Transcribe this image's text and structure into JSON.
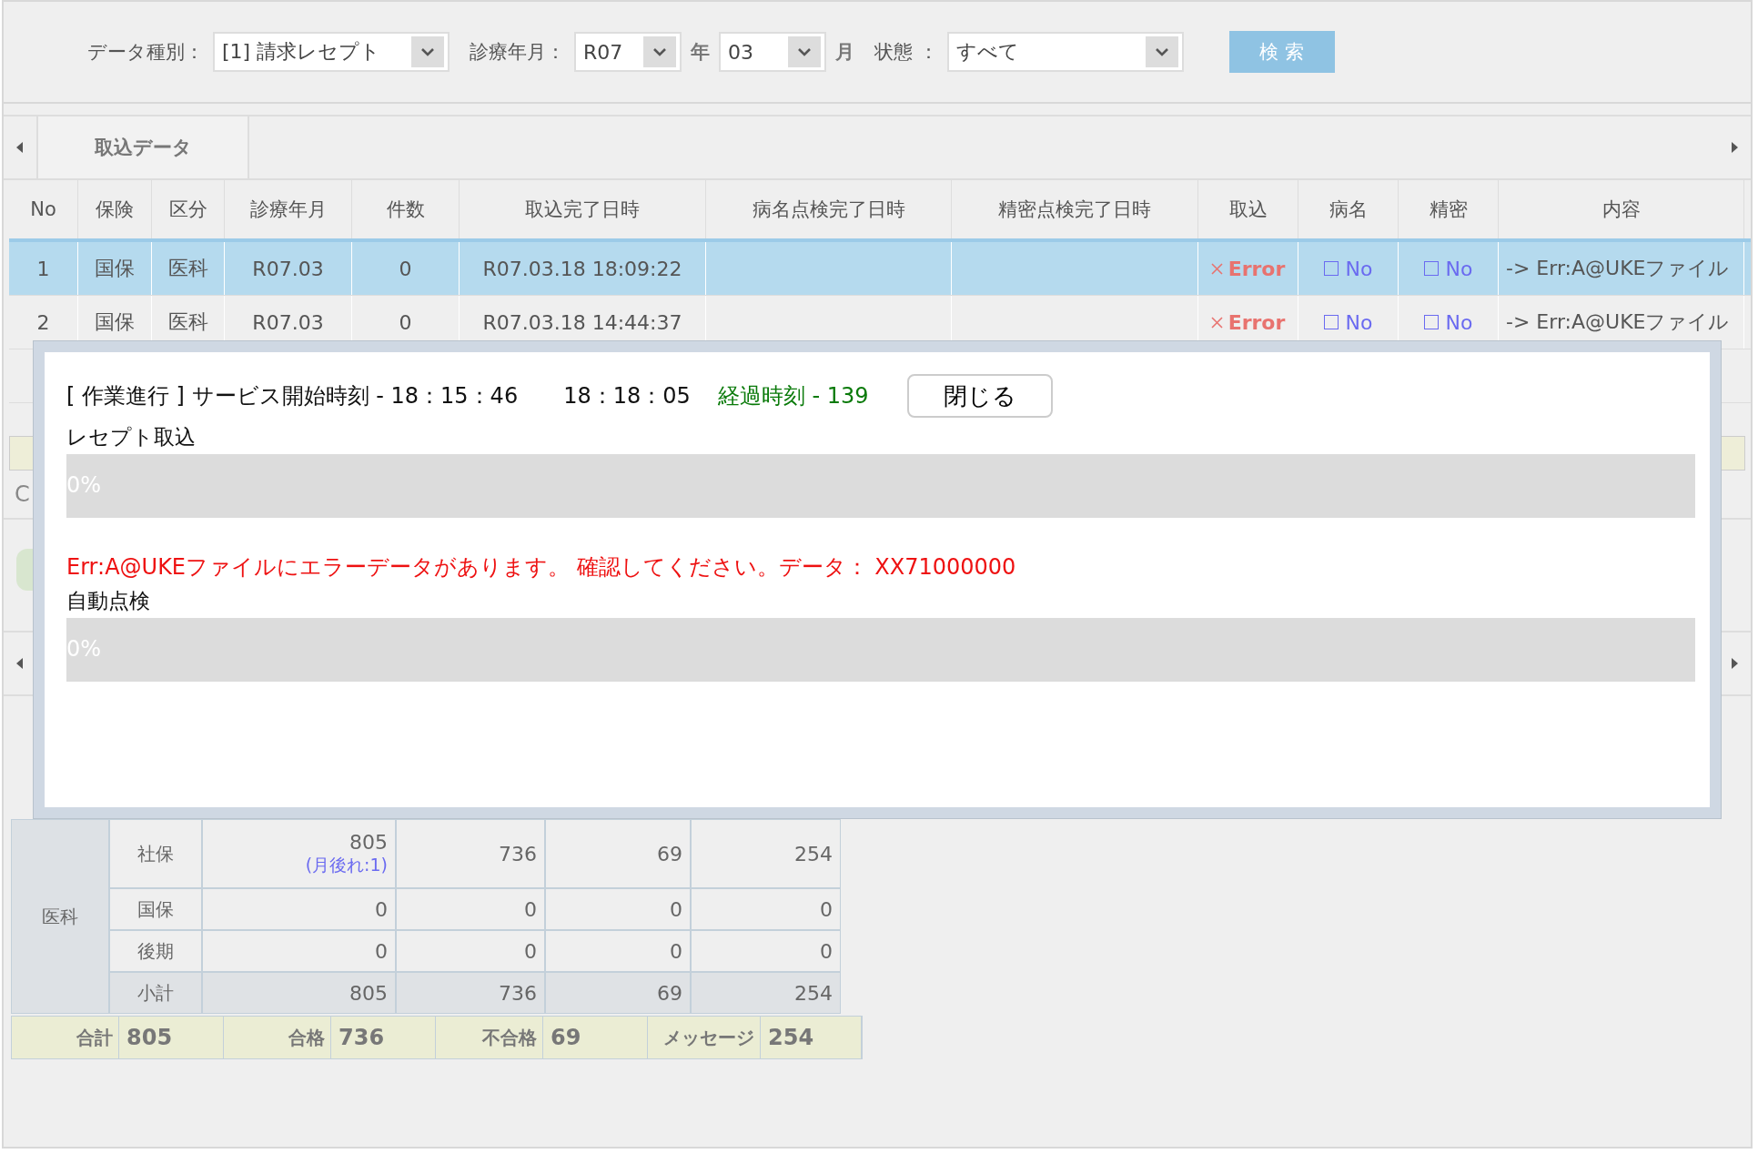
{
  "filters": [
    {
      "label": "データ種別：",
      "value": "[1] 請求レセプト",
      "kind": "wide"
    },
    {
      "label": "診療年月：",
      "value": "R07",
      "kind": "short",
      "suffix": "年"
    },
    {
      "value": "03",
      "kind": "short",
      "suffix": "月"
    },
    {
      "label": "状態 ：",
      "value": "すべて",
      "kind": "wide"
    }
  ],
  "search_button": "検 索",
  "tabs": [
    {
      "label": "取込データ",
      "selected": true
    }
  ],
  "table": {
    "columns": [
      "No",
      "保険",
      "区分",
      "診療年月",
      "件数",
      "取込完了日時",
      "病名点検完了日時",
      "精密点検完了日時",
      "取込",
      "病名",
      "精密",
      "内容"
    ],
    "rows": [
      {
        "selected": true,
        "cells": [
          "1",
          "国保",
          "医科",
          "R07.03",
          "0",
          "R07.03.18 18:09:22",
          "",
          ""
        ],
        "import": {
          "kind": "error",
          "text": "Error"
        },
        "disease": {
          "checked": false,
          "text": "No"
        },
        "detail": {
          "checked": false,
          "text": "No"
        },
        "content": "-> Err:A@UKEファイル"
      },
      {
        "selected": false,
        "cells": [
          "2",
          "国保",
          "医科",
          "R07.03",
          "0",
          "R07.03.18 14:44:37",
          "",
          ""
        ],
        "import": {
          "kind": "error",
          "text": "Error"
        },
        "disease": {
          "checked": false,
          "text": "No"
        },
        "detail": {
          "checked": false,
          "text": "No"
        },
        "content": "-> Err:A@UKEファイル"
      }
    ]
  },
  "toolbar_text": "C",
  "summary": {
    "group": "医科",
    "rows": [
      {
        "label": "社保",
        "values": [
          "805",
          "736",
          "69",
          "254"
        ],
        "note": "(月後れ:1)",
        "subtotal": false
      },
      {
        "label": "国保",
        "values": [
          "0",
          "0",
          "0",
          "0"
        ],
        "subtotal": false
      },
      {
        "label": "後期",
        "values": [
          "0",
          "0",
          "0",
          "0"
        ],
        "subtotal": false
      },
      {
        "label": "小計",
        "values": [
          "805",
          "736",
          "69",
          "254"
        ],
        "subtotal": true
      }
    ]
  },
  "totals": [
    {
      "label": "合計",
      "value": "805"
    },
    {
      "label": "合格",
      "value": "736"
    },
    {
      "label": "不合格",
      "value": "69"
    },
    {
      "label": "メッセージ",
      "value": "254"
    }
  ],
  "dialog": {
    "status": "[ 作業進行 ] サービス開始時刻 - 18：15：46",
    "current_time": "18：18：05",
    "elapsed": "経過時刻 - 139",
    "close_button": "閉じる",
    "tasks": [
      {
        "label": "レセプト取込",
        "level": 0,
        "reading": "0%",
        "error": "Err:A@UKEファイルにエラーデータがあります。 確認してください。データ： XX71000000"
      },
      {
        "label": "自動点検",
        "level": 0,
        "reading": "0%"
      }
    ]
  }
}
